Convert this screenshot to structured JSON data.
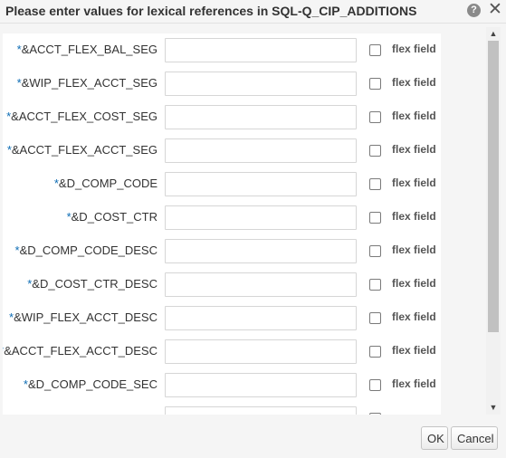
{
  "dialog": {
    "title": "Please enter values for lexical references in SQL-Q_CIP_ADDITIONS",
    "help_icon": "?",
    "close_icon": "✕"
  },
  "form": {
    "required_marker": "*",
    "flex_label": "flex field",
    "rows": [
      {
        "label": "&ACCT_FLEX_BAL_SEG",
        "value": "",
        "flex_checked": false
      },
      {
        "label": "&WIP_FLEX_ACCT_SEG",
        "value": "",
        "flex_checked": false
      },
      {
        "label": "&ACCT_FLEX_COST_SEG",
        "value": "",
        "flex_checked": false
      },
      {
        "label": "&ACCT_FLEX_ACCT_SEG",
        "value": "",
        "flex_checked": false
      },
      {
        "label": "&D_COMP_CODE",
        "value": "",
        "flex_checked": false
      },
      {
        "label": "&D_COST_CTR",
        "value": "",
        "flex_checked": false
      },
      {
        "label": "&D_COMP_CODE_DESC",
        "value": "",
        "flex_checked": false
      },
      {
        "label": "&D_COST_CTR_DESC",
        "value": "",
        "flex_checked": false
      },
      {
        "label": "&WIP_FLEX_ACCT_DESC",
        "value": "",
        "flex_checked": false
      },
      {
        "label": "&ACCT_FLEX_ACCT_DESC",
        "value": "",
        "flex_checked": false
      },
      {
        "label": "&D_COMP_CODE_SEC",
        "value": "",
        "flex_checked": false
      },
      {
        "label": "",
        "value": "",
        "flex_checked": false
      }
    ]
  },
  "scrollbar": {
    "up_arrow": "▲",
    "down_arrow": "▼"
  },
  "footer": {
    "ok_label": "OK",
    "cancel_label": "Cancel"
  }
}
